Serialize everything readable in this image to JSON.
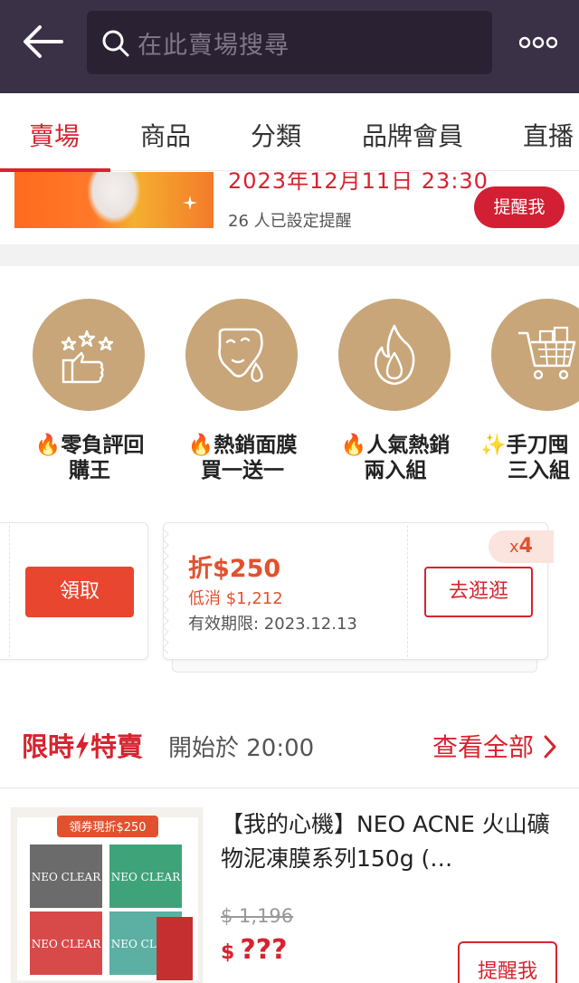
{
  "header": {
    "search_placeholder": "在此賣場搜尋"
  },
  "tabs": [
    {
      "label": "賣場",
      "active": true
    },
    {
      "label": "商品"
    },
    {
      "label": "分類"
    },
    {
      "label": "品牌會員"
    },
    {
      "label": "直播"
    }
  ],
  "live": {
    "date": "2023年12月11日 23:30",
    "count": "26 人已設定提醒",
    "remind_label": "提醒我"
  },
  "categories": [
    {
      "icon": "thumbs-up-stars-icon",
      "line1": "零負評回",
      "line2": "購王",
      "emoji": "🔥"
    },
    {
      "icon": "face-mask-icon",
      "line1": "熱銷面膜",
      "line2": "買一送一",
      "emoji": "🔥"
    },
    {
      "icon": "flame-icon",
      "line1": "人氣熱銷",
      "line2": "兩入組",
      "emoji": "🔥"
    },
    {
      "icon": "shopping-cart-icon",
      "line1": "手刀囤",
      "line2": "三入組",
      "emoji": "✨"
    }
  ],
  "coupons": {
    "left_button": "領取",
    "amount": "折$250",
    "min_spend": "低消 $1,212",
    "expiry": "有效期限: 2023.12.13",
    "go_button": "去逛逛",
    "multiplier_prefix": "x",
    "multiplier": "4"
  },
  "flash_sale": {
    "title_part1": "限時",
    "title_part2": "特賣",
    "start": "開始於 20:00",
    "see_all": "查看全部"
  },
  "product": {
    "name": "【我的心機】NEO ACNE 火山礦物泥凍膜系列150g (…",
    "old_price": "$ 1,196",
    "currency": "$",
    "price": "???",
    "remind_label": "提醒我",
    "image_banner": "領券現折$250",
    "image_brand": "NEO CLEAR"
  },
  "colors": {
    "header_bg": "#3a3146",
    "accent": "#d7232f",
    "category_circle": "#c8a679",
    "coupon_orange": "#e8462f"
  }
}
